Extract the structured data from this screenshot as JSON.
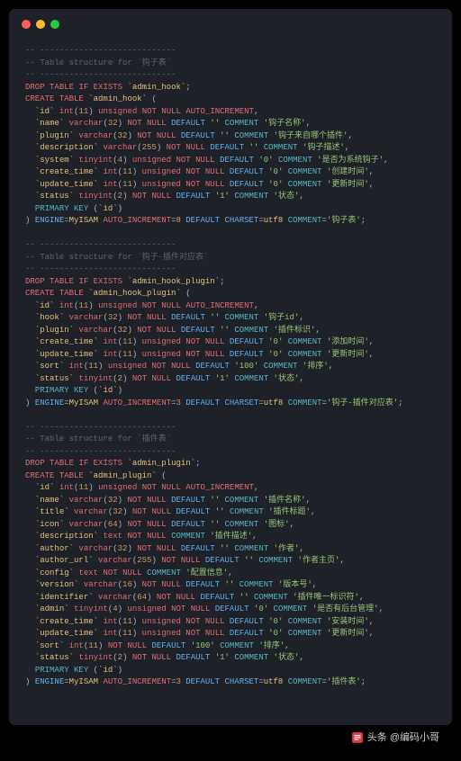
{
  "block1": {
    "dashes": "-- ----------------------------",
    "title": "-- Table structure for `钩子表`",
    "drop": "DROP TABLE IF EXISTS `admin_hook`;",
    "create": "CREATE TABLE `admin_hook` (",
    "c1": "  `id` int(11) unsigned NOT NULL AUTO_INCREMENT,",
    "c2": "  `name` varchar(32) NOT NULL DEFAULT '' COMMENT '钩子名称',",
    "c3": "  `plugin` varchar(32) NOT NULL DEFAULT '' COMMENT '钩子来自哪个插件',",
    "c4": "  `description` varchar(255) NOT NULL DEFAULT '' COMMENT '钩子描述',",
    "c5": "  `system` tinyint(4) unsigned NOT NULL DEFAULT '0' COMMENT '是否为系统钩子',",
    "c6": "  `create_time` int(11) unsigned NOT NULL DEFAULT '0' COMMENT '创建时间',",
    "c7": "  `update_time` int(11) unsigned NOT NULL DEFAULT '0' COMMENT '更新时间',",
    "c8": "  `status` tinyint(2) NOT NULL DEFAULT '1' COMMENT '状态',",
    "pk": "  PRIMARY KEY (`id`)",
    "eng": ") ENGINE=MyISAM AUTO_INCREMENT=8 DEFAULT CHARSET=utf8 COMMENT='钩子表';"
  },
  "block2": {
    "dashes": "-- ----------------------------",
    "title": "-- Table structure for `钩子-插件对应表`",
    "drop": "DROP TABLE IF EXISTS `admin_hook_plugin`;",
    "create": "CREATE TABLE `admin_hook_plugin` (",
    "c1": "  `id` int(11) unsigned NOT NULL AUTO_INCREMENT,",
    "c2": "  `hook` varchar(32) NOT NULL DEFAULT '' COMMENT '钩子id',",
    "c3": "  `plugin` varchar(32) NOT NULL DEFAULT '' COMMENT '插件标识',",
    "c4": "  `create_time` int(11) unsigned NOT NULL DEFAULT '0' COMMENT '添加时间',",
    "c5": "  `update_time` int(11) unsigned NOT NULL DEFAULT '0' COMMENT '更新时间',",
    "c6": "  `sort` int(11) unsigned NOT NULL DEFAULT '100' COMMENT '排序',",
    "c7": "  `status` tinyint(2) NOT NULL DEFAULT '1' COMMENT '状态',",
    "pk": "  PRIMARY KEY (`id`)",
    "eng": ") ENGINE=MyISAM AUTO_INCREMENT=3 DEFAULT CHARSET=utf8 COMMENT='钩子-插件对应表';"
  },
  "block3": {
    "dashes": "-- ----------------------------",
    "title": "-- Table structure for `插件表`",
    "drop": "DROP TABLE IF EXISTS `admin_plugin`;",
    "create": "CREATE TABLE `admin_plugin` (",
    "c1": "  `id` int(11) unsigned NOT NULL AUTO_INCREMENT,",
    "c2": "  `name` varchar(32) NOT NULL DEFAULT '' COMMENT '插件名称',",
    "c3": "  `title` varchar(32) NOT NULL DEFAULT '' COMMENT '插件标题',",
    "c4": "  `icon` varchar(64) NOT NULL DEFAULT '' COMMENT '图标',",
    "c5": "  `description` text NOT NULL COMMENT '插件描述',",
    "c6": "  `author` varchar(32) NOT NULL DEFAULT '' COMMENT '作者',",
    "c7": "  `author_url` varchar(255) NOT NULL DEFAULT '' COMMENT '作者主页',",
    "c8": "  `config` text NOT NULL COMMENT '配置信息',",
    "c9": "  `version` varchar(16) NOT NULL DEFAULT '' COMMENT '版本号',",
    "c10": "  `identifier` varchar(64) NOT NULL DEFAULT '' COMMENT '插件唯一标识符',",
    "c11": "  `admin` tinyint(4) unsigned NOT NULL DEFAULT '0' COMMENT '是否有后台管理',",
    "c12": "  `create_time` int(11) unsigned NOT NULL DEFAULT '0' COMMENT '安装时间',",
    "c13": "  `update_time` int(11) unsigned NOT NULL DEFAULT '0' COMMENT '更新时间',",
    "c14": "  `sort` int(11) NOT NULL DEFAULT '100' COMMENT '排序',",
    "c15": "  `status` tinyint(2) NOT NULL DEFAULT '1' COMMENT '状态',",
    "pk": "  PRIMARY KEY (`id`)",
    "eng": ") ENGINE=MyISAM AUTO_INCREMENT=3 DEFAULT CHARSET=utf8 COMMENT='插件表';"
  },
  "footer": "头条 @编码小哥"
}
